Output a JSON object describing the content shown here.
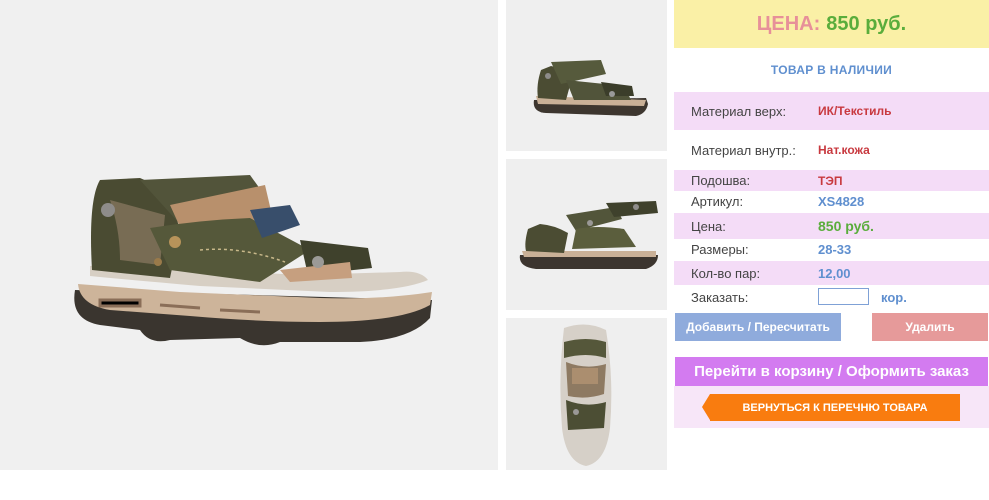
{
  "price_box": {
    "label": "ЦЕНА:",
    "value": "850 руб."
  },
  "stock_status": "ТОВАР В НАЛИЧИИ",
  "specs": [
    {
      "label": "Материал верх:",
      "value": "ИК/Текстиль"
    },
    {
      "label": "Материал внутр.:",
      "value": "Нат.кожа"
    },
    {
      "label": "Подошва:",
      "value": "ТЭП"
    },
    {
      "label": "Артикул:",
      "value": "XS4828"
    },
    {
      "label": "Цена:",
      "value": "850 руб."
    },
    {
      "label": "Размеры:",
      "value": "28-33"
    },
    {
      "label": "Кол-во пар:",
      "value": "12,00"
    }
  ],
  "order": {
    "label": "Заказать:",
    "value": "",
    "unit": "кор."
  },
  "buttons": {
    "add": "Добавить / Пересчитать",
    "delete": "Удалить",
    "cart": "Перейти в корзину / Оформить заказ",
    "back": "ВЕРНУТЬСЯ К ПЕРЕЧНЮ ТОВАРА"
  },
  "product_images": [
    "sandal-side-photo",
    "sandal-angle-photo",
    "sandal-outer-side-photo",
    "sandal-top-photo"
  ],
  "colors": {
    "price_bg": "#faf0a6",
    "price_label": "#e79099",
    "price_value": "#5aad3c",
    "spec_row_bg": "#f4dcf7",
    "add_btn": "#8fabdc",
    "delete_btn": "#e69a9a",
    "cart_btn": "#d37bf0",
    "back_btn": "#f97c0f"
  }
}
